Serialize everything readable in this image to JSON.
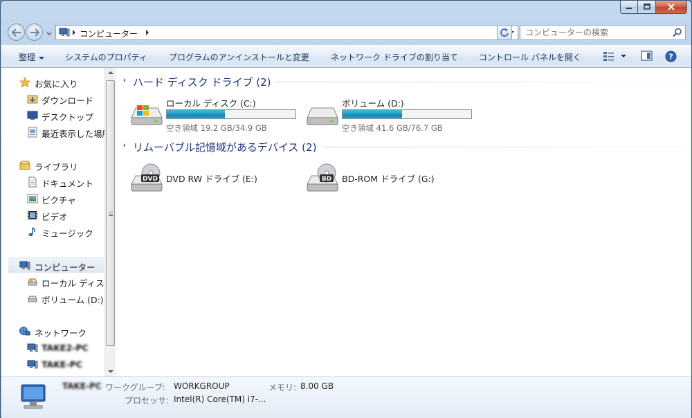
{
  "window": {
    "caption": {
      "minimize": "minimize",
      "maximize": "maximize",
      "close": "close"
    }
  },
  "address_bar": {
    "crumbs": [
      "コンピューター"
    ],
    "search_placeholder": "コンピューターの検索"
  },
  "command_bar": {
    "organize": "整理",
    "system_properties": "システムのプロパティ",
    "uninstall": "プログラムのアンインストールと変更",
    "map_drive": "ネットワーク ドライブの割り当て",
    "control_panel": "コントロール パネルを開く"
  },
  "nav_pane": {
    "favorites": {
      "label": "お気に入り",
      "items": [
        "ダウンロード",
        "デスクトップ",
        "最近表示した場所"
      ]
    },
    "libraries": {
      "label": "ライブラリ",
      "items": [
        "ドキュメント",
        "ピクチャ",
        "ビデオ",
        "ミュージック"
      ]
    },
    "computer": {
      "label": "コンピューター",
      "items": [
        "ローカル ディスク (C:)",
        "ボリューム (D:)"
      ]
    },
    "network": {
      "label": "ネットワーク",
      "items": [
        "TAKE2-PC",
        "TAKE-PC"
      ]
    }
  },
  "groups": {
    "hdd": {
      "title": "ハード ディスク ドライブ (2)",
      "drives": [
        {
          "name": "ローカル ディスク (C:)",
          "free_text": "空き領域 19.2 GB/34.9 GB",
          "used_fraction": 0.45
        },
        {
          "name": "ボリューム (D:)",
          "free_text": "空き領域 41.6 GB/76.7 GB",
          "used_fraction": 0.46
        }
      ]
    },
    "removable": {
      "title": "リムーバブル記憶域があるデバイス (2)",
      "devices": [
        {
          "name": "DVD RW ドライブ (E:)",
          "badge": "DVD"
        },
        {
          "name": "BD-ROM ドライブ (G:)",
          "badge": "BD"
        }
      ]
    }
  },
  "details": {
    "pc_name": "TAKE-PC",
    "workgroup_label": "ワークグループ:",
    "workgroup_value": "WORKGROUP",
    "memory_label": "メモリ:",
    "memory_value": "8.00 GB",
    "processor_label": "プロセッサ:",
    "processor_value": "Intel(R) Core(TM) i7-..."
  },
  "colors": {
    "group_title": "#1e3287",
    "bar_fill": "#26a0c8",
    "frame": "#b3cbe6"
  },
  "icons": {
    "star": "star-icon",
    "downloads": "downloads-folder-icon",
    "desktop": "desktop-icon",
    "recent": "recent-places-icon",
    "library": "library-icon",
    "document": "document-icon",
    "picture": "picture-icon",
    "video": "video-icon",
    "music": "music-note-icon",
    "computer": "computer-icon",
    "network": "network-globe-icon",
    "hdd": "hard-drive-icon",
    "optical": "optical-drive-icon"
  }
}
